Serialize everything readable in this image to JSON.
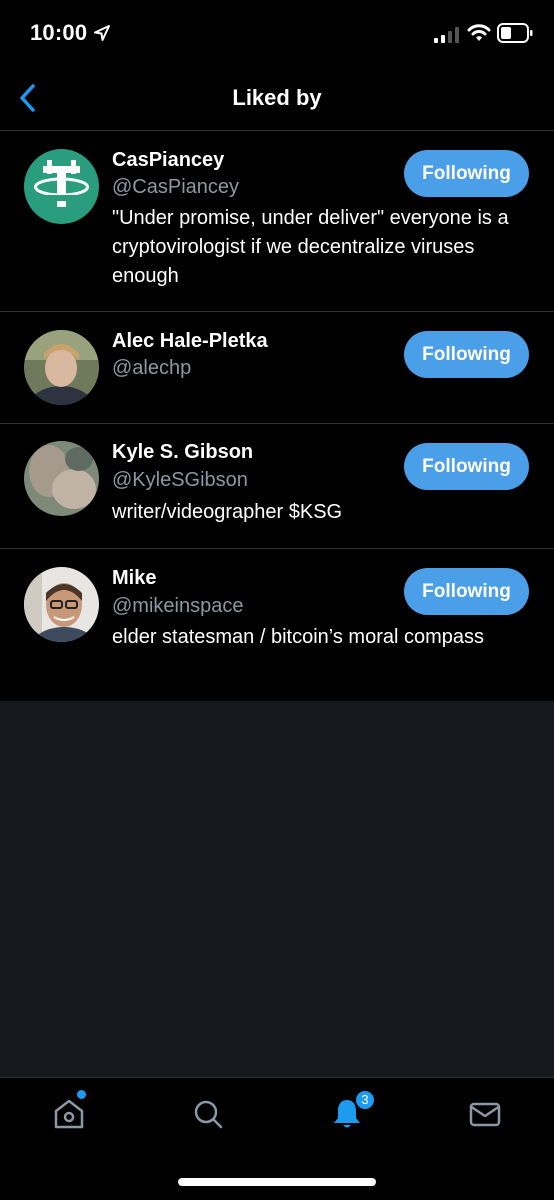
{
  "status_bar": {
    "time": "10:00"
  },
  "nav": {
    "title": "Liked by"
  },
  "users": [
    {
      "name": "CasPiancey",
      "handle": "@CasPiancey",
      "bio": "\"Under promise, under deliver\" everyone is a cryptovirologist if we decentralize viruses enough",
      "button": "Following"
    },
    {
      "name": "Alec Hale-Pletka",
      "handle": "@alechp",
      "bio": "",
      "button": "Following"
    },
    {
      "name": "Kyle S. Gibson",
      "handle": "@KyleSGibson",
      "bio": "writer/videographer $KSG",
      "button": "Following"
    },
    {
      "name": "Mike",
      "handle": "@mikeinspace",
      "bio": "elder statesman / bitcoin’s moral compass",
      "button": "Following"
    }
  ],
  "tabbar": {
    "notifications_badge": "3"
  },
  "colors": {
    "accent": "#1d9bf0",
    "button": "#4a9fe8",
    "handle": "#8b98a5",
    "empty_bg": "#15181c"
  }
}
